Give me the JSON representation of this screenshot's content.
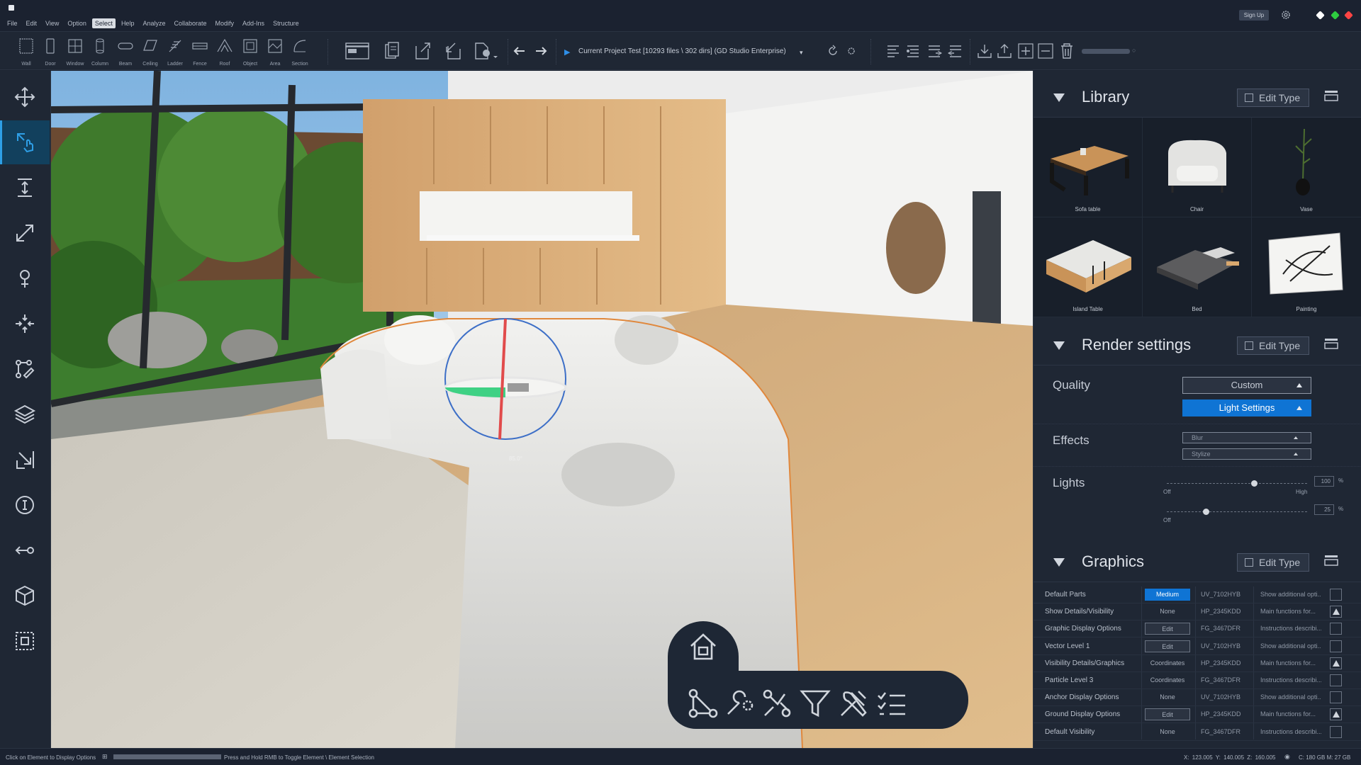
{
  "menu": [
    "File",
    "Edit",
    "View",
    "Option",
    "Select",
    "Help",
    "Analyze",
    "Collaborate",
    "Modify",
    "Add-Ins",
    "Structure"
  ],
  "menu_active": "Select",
  "signup": "Sign Up",
  "window_dots": {
    "left": "#ffffff",
    "mid": "#2ecc40",
    "right": "#ff4444"
  },
  "ribbon": {
    "tools": [
      "Wall",
      "Door",
      "Window",
      "Column",
      "Beam",
      "Ceiling",
      "Ladder",
      "Fence",
      "Roof",
      "Object",
      "Area",
      "Section"
    ],
    "project_path": "Current Project Test  [10293 files \\ 302 dirs] (GD Studio Enterprise)"
  },
  "left_tools": [
    "move-icon",
    "select-touch-icon",
    "height-icon",
    "scale-icon",
    "pin-icon",
    "align-icon",
    "path-edit-icon",
    "layers-icon",
    "snap-icon",
    "info-icon",
    "back-icon",
    "cube-icon",
    "focus-icon"
  ],
  "viewport": {
    "rotation_label": "85.0°"
  },
  "floating_bar": [
    "home-icon",
    "nodes-icon",
    "tools-icon",
    "route-icon",
    "filter-icon",
    "wrench-icon",
    "checklist-icon"
  ],
  "library": {
    "title": "Library",
    "edit_type": "Edit Type",
    "items": [
      "Sofa table",
      "Chair",
      "Vase",
      "Island Table",
      "Bed",
      "Painting"
    ]
  },
  "render": {
    "title": "Render settings",
    "edit_type": "Edit Type",
    "quality_label": "Quality",
    "quality_value": "Custom",
    "light_settings": "Light Settings",
    "effects_label": "Effects",
    "effect1": "Blur",
    "effect2": "Stylize",
    "lights_label": "Lights",
    "slider1": {
      "min": "Off",
      "max": "High",
      "value": "100",
      "unit": "%",
      "fraction": 0.62
    },
    "slider2": {
      "min": "Off",
      "value": "25",
      "unit": "%",
      "fraction": 0.28
    }
  },
  "graphics": {
    "title": "Graphics",
    "edit_type": "Edit Type",
    "rows": [
      {
        "name": "Default Parts",
        "value": "Medium",
        "code": "UV_7102HYB",
        "desc": "Show additional opti...",
        "up": false
      },
      {
        "name": "Show Details/Visibility",
        "value": "None",
        "code": "HP_2345KDD",
        "desc": "Main functions for...",
        "up": true
      },
      {
        "name": "Graphic Display Options",
        "value": "Edit",
        "code": "FG_3467DFR",
        "desc": "Instructions describi...",
        "up": false
      },
      {
        "name": "Vector Level 1",
        "value": "Edit",
        "code": "UV_7102HYB",
        "desc": "Show additional opti...",
        "up": false
      },
      {
        "name": "Visibility Details/Graphics",
        "value": "Coordinates",
        "code": "HP_2345KDD",
        "desc": "Main functions for...",
        "up": true
      },
      {
        "name": "Particle Level 3",
        "value": "Coordinates",
        "code": "FG_3467DFR",
        "desc": "Instructions describi...",
        "up": false
      },
      {
        "name": "Anchor Display Options",
        "value": "None",
        "code": "UV_7102HYB",
        "desc": "Show additional opti...",
        "up": false
      },
      {
        "name": "Ground Display Options",
        "value": "Edit",
        "code": "HP_2345KDD",
        "desc": "Main functions for...",
        "up": true
      },
      {
        "name": "Default Visibility",
        "value": "None",
        "code": "FG_3467DFR",
        "desc": "Instructions describi...",
        "up": false
      }
    ]
  },
  "status": {
    "left": "Click on Element to Display Options",
    "hint": "Press and Hold RMB to Toggle Element \\ Element Selection",
    "coords": "X: 123.005   Y: 140.005   Z: 160.005",
    "storage": "C: 180 GB   M: 27 GB"
  }
}
